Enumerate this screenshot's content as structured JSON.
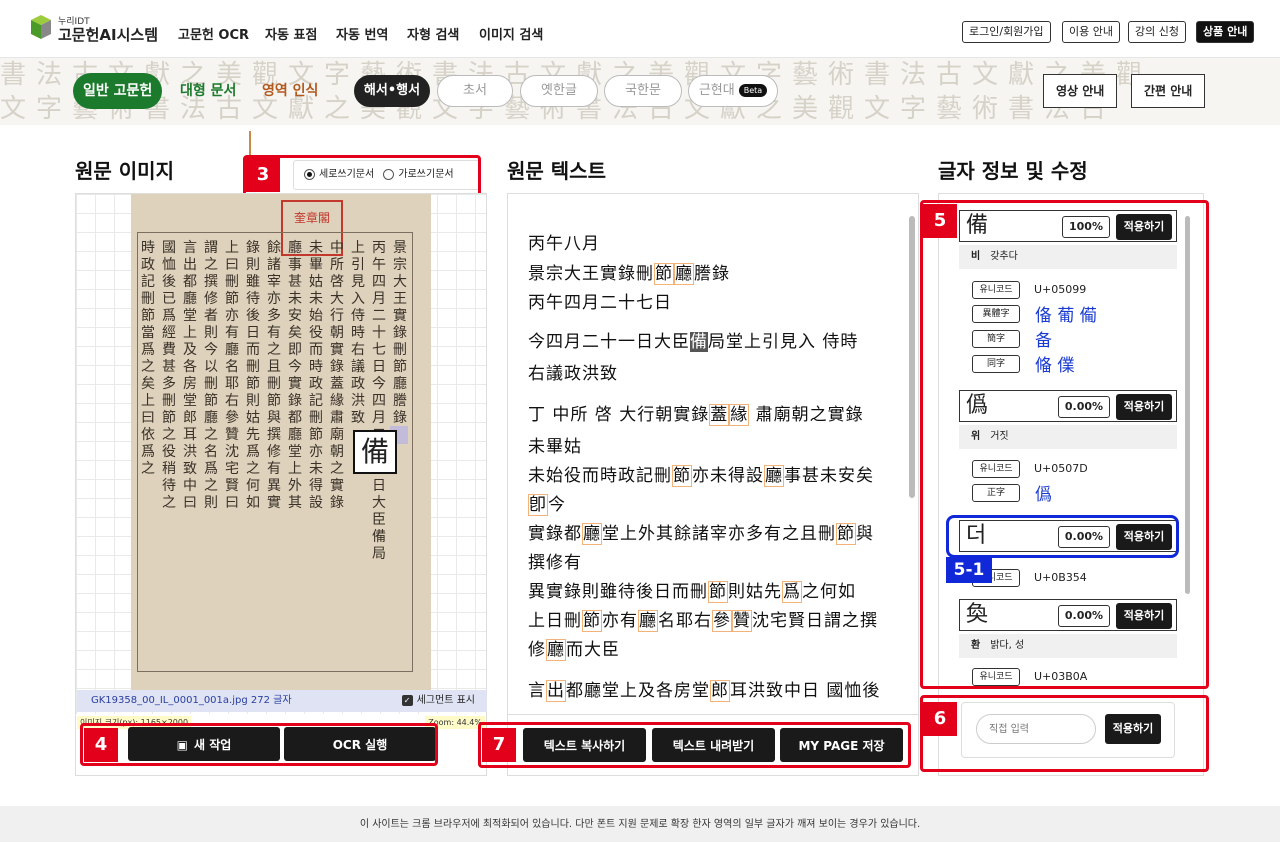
{
  "header": {
    "brand_small": "누리IDT",
    "brand_name": "고문헌AI시스템",
    "nav": [
      "고문헌 OCR",
      "자동 표점",
      "자동 번역",
      "자형 검색",
      "이미지 검색"
    ],
    "buttons": [
      "로그인/회원가입",
      "이용 안내",
      "강의 신청",
      "상품 안내"
    ]
  },
  "modebar": {
    "doc_types": [
      "일반 고문헌",
      "대형 문서",
      "영역 인식"
    ],
    "script_pills": [
      "해서•행서",
      "초서",
      "옛한글",
      "국한문",
      "근현대"
    ],
    "beta_badge": "Beta",
    "guide_buttons": [
      "영상 안내",
      "간편 안내"
    ]
  },
  "source_image": {
    "title": "원문 이미지",
    "orientation_options": [
      "세로쓰기문서",
      "가로쓰기문서"
    ],
    "selected_orientation": "세로쓰기문서",
    "file_info": "GK19358_00_IL_0001_001a.jpg 272 글자",
    "segment_toggle": "세그먼트 표시",
    "image_size_note": "이미지 크기(px): 1165×2000",
    "zoom_note": "Zoom: 44.4%",
    "zoom_char": "備",
    "seal_text": "奎章閣",
    "buttons": {
      "new_task": "새 작업",
      "ocr_run": "OCR 실행"
    },
    "columns": [
      "景宗大王實錄刪節廳謄錄",
      "丙午四月二十七日今四月二十一日大臣備局",
      "上引見入侍時右議政洪致",
      "中所啓大行朝實錄蓋緣肅廟朝之實錄",
      "未畢姑未始役而時政記刪節亦未得設",
      "廳事甚未安矣即今實錄都廳堂上外其",
      "餘諸宰亦多有之且刪節與撰修有異實",
      "錄則雖待後日而刪節則姑先爲之何如",
      "上曰刪節亦有廳名耶右參贊沈宅賢曰",
      "謂之撰修者則今以刪節廳之名爲之則",
      "言出都廳堂上及各房堂郎耳洪致中曰",
      "國恤後已爲經費甚多刪節之役稍待之",
      "時政記刪節當爲之矣上曰依爲之"
    ]
  },
  "source_text": {
    "title": "원문 텍스트",
    "lines": [
      "丙午八月",
      "景宗大王實錄刪節廳謄錄",
      "丙午四月二十七日",
      "今四月二十一日大臣備局堂上引見入 侍時",
      "右議政洪致",
      "丁 中所 啓 大行朝實錄蓋緣 肅廟朝之實錄",
      "未畢姑",
      "未始役而時政記刪節亦未得設廳事甚未安矣",
      "卽今",
      "實錄都廳堂上外其餘諸宰亦多有之且刪節與",
      "撰修有",
      "異實錄則雖待後日而刪節則姑先爲之何如",
      "上日刪節亦有廳名耶右參贊沈宅賢日謂之撰",
      "修廳而大臣",
      "言出都廳堂上及各房堂郎耳洪致中日 國恤後"
    ],
    "buttons": {
      "copy": "텍스트 복사하기",
      "download": "텍스트 내려받기",
      "save": "MY PAGE 저장"
    }
  },
  "char_info": {
    "title": "글자 정보 및 수정",
    "apply_label": "적용하기",
    "candidates": [
      {
        "char": "備",
        "confidence": "100%",
        "reading": "비",
        "meaning": "갖추다",
        "unicode_label": "유니코드",
        "unicode": "U+05099",
        "variants": [
          {
            "label": "異體字",
            "chars": "俻 葡 僃"
          },
          {
            "label": "簡字",
            "chars": "备"
          },
          {
            "label": "同字",
            "chars": "偹 㒒"
          }
        ]
      },
      {
        "char": "僞",
        "confidence": "0.00%",
        "reading": "위",
        "meaning": "거짓",
        "unicode_label": "유니코드",
        "unicode": "U+0507D",
        "variants": [
          {
            "label": "正字",
            "chars": "僞"
          }
        ]
      },
      {
        "char": "더",
        "confidence": "0.00%",
        "unicode_label": "유니코드",
        "unicode": "U+0B354"
      },
      {
        "char": "奐",
        "confidence": "0.00%",
        "reading": "환",
        "meaning": "밝다, 성",
        "unicode_label": "유니코드",
        "unicode": "U+03B0A"
      }
    ],
    "direct_input_placeholder": "직접 입력"
  },
  "annotations": {
    "tags": [
      "3",
      "4",
      "5",
      "5-1",
      "6",
      "7"
    ],
    "tag_color": "#e3001b",
    "highlight_color": "#1028d8"
  },
  "footer": {
    "notice": "이 사이트는 크롬 브라우저에 최적화되어 있습니다. 다만 폰트 지원 문제로 확장 한자 영역의 일부 글자가 깨져 보이는 경우가 있습니다."
  }
}
